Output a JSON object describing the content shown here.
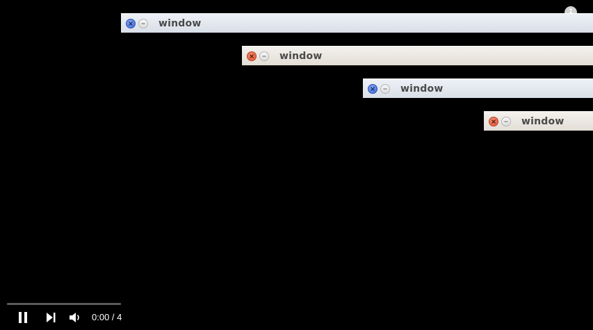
{
  "windows": [
    {
      "title": "window",
      "theme": "blue"
    },
    {
      "title": "window",
      "theme": "orange"
    },
    {
      "title": "window",
      "theme": "blue"
    },
    {
      "title": "window",
      "theme": "orange"
    }
  ],
  "icons": {
    "close": "close-icon",
    "minimize": "minimize-icon",
    "more": "more-options-icon",
    "pause": "pause-icon",
    "next": "skip-next-icon",
    "volume": "volume-icon"
  },
  "player": {
    "time_text": "0:00 / 4",
    "progress": 0
  },
  "colors": {
    "background": "#000000",
    "close_blue": "#3a64d8",
    "close_orange": "#e0502c"
  }
}
